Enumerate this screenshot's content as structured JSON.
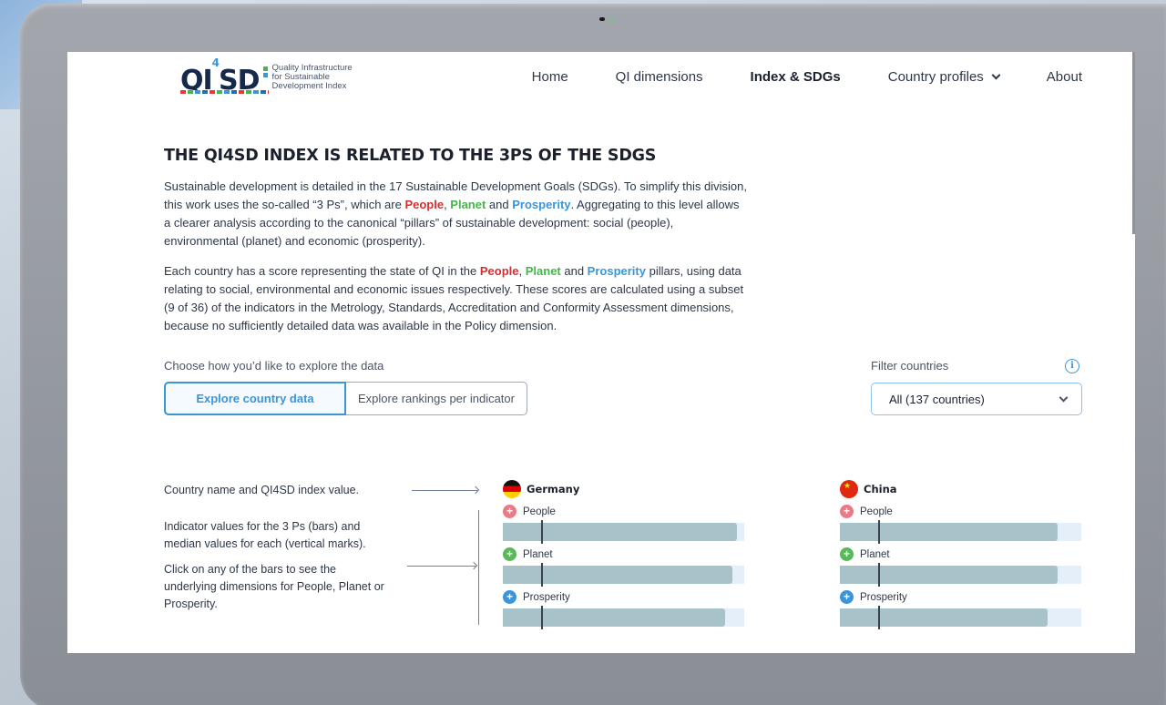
{
  "header": {
    "logo": {
      "mark": "QI4SD",
      "text_lines": [
        "Quality Infrastructure",
        "for Sustainable",
        "Development Index"
      ]
    },
    "nav": [
      {
        "label": "Home",
        "active": false
      },
      {
        "label": "QI dimensions",
        "active": false
      },
      {
        "label": "Index & SDGs",
        "active": true
      },
      {
        "label": "Country profiles",
        "active": false,
        "dropdown": true
      },
      {
        "label": "About",
        "active": false
      }
    ]
  },
  "content": {
    "heading": "THE QI4SD INDEX IS RELATED TO THE 3PS OF THE SDGS",
    "p1": {
      "a": "Sustainable development is detailed in the 17 Sustainable Development Goals (SDGs). To simplify this division, this work uses the so-called “3 Ps”, which are ",
      "people": "People",
      "comma": ", ",
      "planet": "Planet",
      "and": " and ",
      "prosperity": "Prosperity",
      "b": ". Aggregating to this level allows a clearer analysis according to the canonical “pillars” of sustainable development: social (people), environmental (planet) and economic (prosperity)."
    },
    "p2": {
      "a": "Each country has a score representing the state of QI in the ",
      "people": "People",
      "comma": ", ",
      "planet": "Planet",
      "and": " and ",
      "prosperity": "Prosperity",
      "b": " pillars, using data relating to social, environmental and economic issues respectively. These scores are calculated using a subset (9 of 36) of the indicators in the Metrology, Standards, Accreditation and Conformity Assessment dimensions, because no sufficiently detailed data was available in the Policy dimension."
    }
  },
  "explore": {
    "label": "Choose how you’d like to explore the data",
    "options": [
      "Explore country data",
      "Explore rankings per indicator"
    ],
    "selected": "Explore country data"
  },
  "filter": {
    "label": "Filter countries",
    "value": "All (137 countries)",
    "info_icon": "info-icon"
  },
  "legend": {
    "line1": "Country name and QI4SD index value.",
    "line2": "Indicator values for the 3 Ps (bars) and median values for each (vertical marks).",
    "line3": "Click on any of the bars to see the underlying dimensions for People, Planet or Prosperity."
  },
  "countries": [
    {
      "name": "Germany",
      "flag": "germany-flag",
      "pillars": [
        {
          "name": "People",
          "value": 0.97,
          "median": 0.16
        },
        {
          "name": "Planet",
          "value": 0.95,
          "median": 0.16
        },
        {
          "name": "Prosperity",
          "value": 0.92,
          "median": 0.16
        }
      ]
    },
    {
      "name": "China",
      "flag": "china-flag",
      "pillars": [
        {
          "name": "People",
          "value": 0.9,
          "median": 0.16
        },
        {
          "name": "Planet",
          "value": 0.9,
          "median": 0.16
        },
        {
          "name": "Prosperity",
          "value": 0.86,
          "median": 0.16
        }
      ]
    }
  ],
  "colors": {
    "people": "#d32f2f",
    "planet": "#45b649",
    "prosperity": "#3b95d6",
    "bar": "#a8c2ca",
    "bar_track": "#e4eff9",
    "accent": "#3b95d6"
  }
}
